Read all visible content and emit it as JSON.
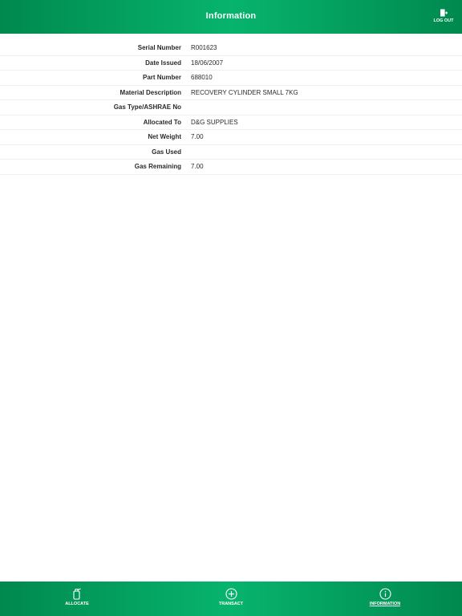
{
  "header": {
    "title": "Information",
    "logout_label": "LOG OUT"
  },
  "info": {
    "rows": [
      {
        "label": "Serial Number",
        "value": "R001623"
      },
      {
        "label": "Date Issued",
        "value": "18/06/2007"
      },
      {
        "label": "Part Number",
        "value": "688010"
      },
      {
        "label": "Material Description",
        "value": "RECOVERY CYLINDER SMALL 7KG"
      },
      {
        "label": "Gas Type/ASHRAE No",
        "value": ""
      },
      {
        "label": "Allocated To",
        "value": "D&G SUPPLIES"
      },
      {
        "label": "Net Weight",
        "value": "7.00"
      },
      {
        "label": "Gas Used",
        "value": ""
      },
      {
        "label": "Gas Remaining",
        "value": "7.00"
      }
    ]
  },
  "nav": {
    "allocate": {
      "label": "ALLOCATE",
      "icon": "cylinder-icon"
    },
    "transact": {
      "label": "TRANSACT",
      "icon": "plus-circle-icon"
    },
    "information": {
      "label": "INFORMATION",
      "icon": "info-circle-icon",
      "active": true
    }
  },
  "colors": {
    "brand_green": "#07b46d",
    "brand_green_dark": "#00894f",
    "text": "#2b2b2b"
  }
}
